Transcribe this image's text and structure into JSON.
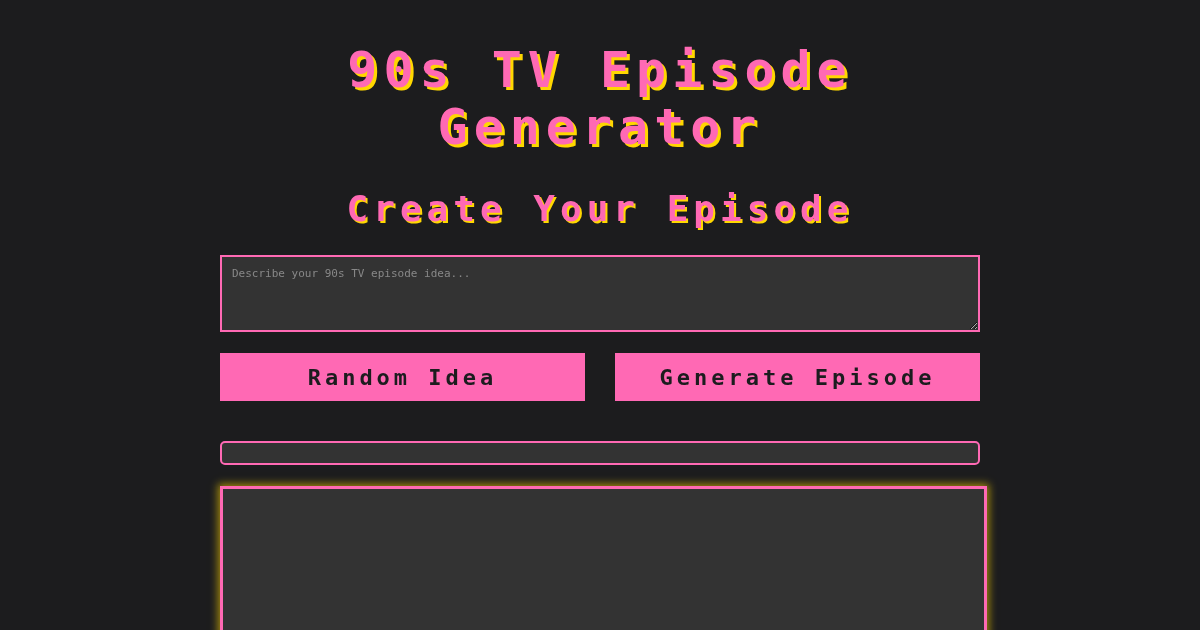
{
  "title": "90s TV Episode Generator",
  "form": {
    "heading": "Create Your Episode",
    "idea_field": {
      "placeholder": "Describe your 90s TV episode idea..."
    },
    "buttons": [
      "Random Idea",
      "Generate Episode"
    ]
  },
  "progress": {
    "level": 0
  }
}
